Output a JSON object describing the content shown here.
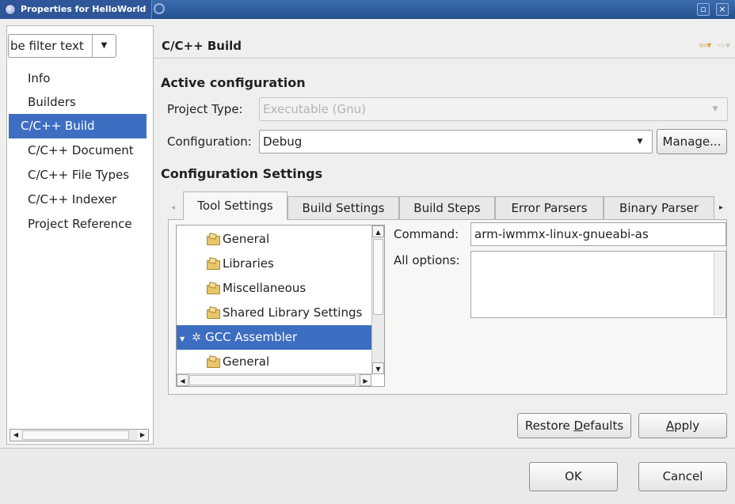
{
  "window": {
    "title": "Properties for HelloWorld"
  },
  "filter": {
    "value": "be filter text"
  },
  "nav": {
    "items": [
      {
        "label": "Info"
      },
      {
        "label": "Builders"
      },
      {
        "label": "C/C++ Build"
      },
      {
        "label": "C/C++ Document"
      },
      {
        "label": "C/C++ File Types"
      },
      {
        "label": "C/C++ Indexer"
      },
      {
        "label": "Project Reference"
      }
    ],
    "selected": "C/C++ Build"
  },
  "page": {
    "title": "C/C++ Build",
    "active_config_heading": "Active configuration",
    "project_type_label": "Project Type:",
    "project_type_value": "Executable (Gnu)",
    "configuration_label": "Configuration:",
    "configuration_value": "Debug",
    "manage_label": "Manage...",
    "config_settings_heading": "Configuration Settings"
  },
  "tabs": [
    {
      "label": "Tool Settings"
    },
    {
      "label": "Build Settings"
    },
    {
      "label": "Build Steps"
    },
    {
      "label": "Error Parsers"
    },
    {
      "label": "Binary Parser"
    }
  ],
  "active_tab": "Tool Settings",
  "tree": {
    "items": [
      {
        "label": "General",
        "icon": "folder-icon"
      },
      {
        "label": "Libraries",
        "icon": "folder-icon"
      },
      {
        "label": "Miscellaneous",
        "icon": "folder-icon"
      },
      {
        "label": "Shared Library Settings",
        "icon": "folder-icon"
      },
      {
        "label": "GCC Assembler",
        "icon": "gear-icon",
        "selected": true,
        "expanded": true
      },
      {
        "label": "General",
        "icon": "folder-icon"
      }
    ]
  },
  "tool": {
    "command_label": "Command:",
    "command_value": "arm-iwmmx-linux-gnueabi-as",
    "all_options_label": "All options:",
    "all_options_value": ""
  },
  "buttons": {
    "restore_pre": "Restore ",
    "restore_mn": "D",
    "restore_post": "efaults",
    "apply_mn": "A",
    "apply_post": "pply",
    "ok": "OK",
    "cancel": "Cancel"
  },
  "colors": {
    "selection": "#3d6ec1",
    "titlebar": "#2e5698",
    "nav_arrow": "#d6a63f"
  }
}
